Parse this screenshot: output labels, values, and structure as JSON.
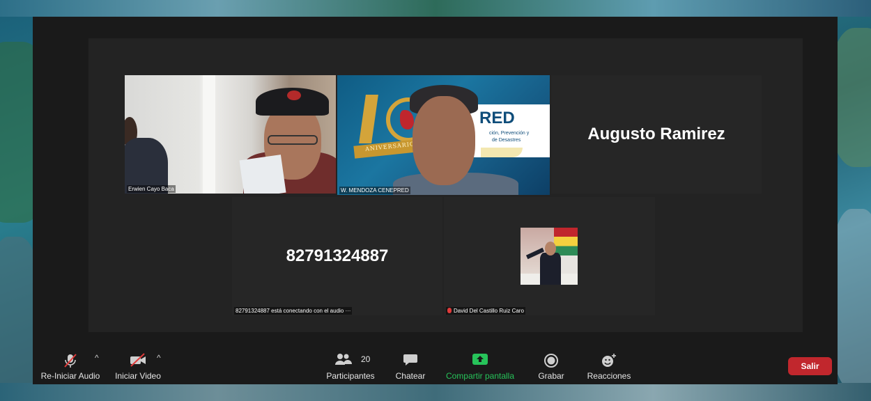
{
  "participants": [
    {
      "name": "Erwien Cayo Baca"
    },
    {
      "name": "W. MENDOZA CENEPRED",
      "active": true,
      "banner_title": "RED",
      "banner_line1": "ción, Prevención y",
      "banner_line2": "de Desastres",
      "ribbon_text": "ANIVERSARIO"
    },
    {
      "display_text": "Augusto Ramirez"
    },
    {
      "display_text": "82791324887",
      "status_text": "82791324887 está conectando con el audio ···"
    },
    {
      "name": "David Del Castillo Ruiz Caro",
      "muted": true
    }
  ],
  "toolbar": {
    "audio_label": "Re-Iniciar Audio",
    "video_label": "Iniciar Video",
    "participants_label": "Participantes",
    "participants_count": "20",
    "chat_label": "Chatear",
    "share_label": "Compartir pantalla",
    "record_label": "Grabar",
    "reactions_label": "Reacciones",
    "leave_label": "Salir",
    "caret": "^"
  },
  "colors": {
    "active_speaker_border": "#d6e85a",
    "share_green": "#27c35a",
    "leave_red": "#c1272d",
    "toolbar_bg": "#1a1a1a"
  }
}
